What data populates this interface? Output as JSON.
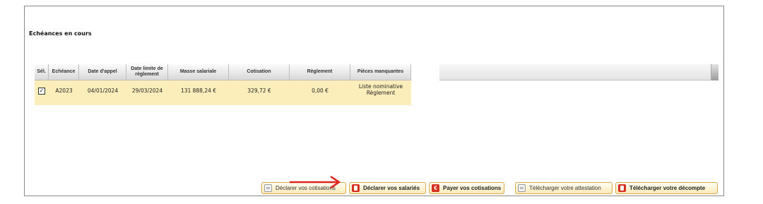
{
  "section_title": "Echéances en cours",
  "table": {
    "headers": [
      "Sél.",
      "Echéance",
      "Date d'appel",
      "Date limite de règlement",
      "Masse salariale",
      "Cotisation",
      "Règlement",
      "Pièces manquantes"
    ],
    "rows": [
      {
        "selected": true,
        "echeance": "A2023",
        "date_appel": "04/01/2024",
        "date_limite": "29/03/2024",
        "masse_salariale": "131 888,24 €",
        "cotisation": "329,72 €",
        "reglement": "0,00 €",
        "pieces_manquantes_1": "Liste nominative",
        "pieces_manquantes_2": "Règlement"
      }
    ]
  },
  "buttons": {
    "declarer_cotisations": "Déclarer vos cotisations",
    "declarer_salaries": "Déclarer vos salariés",
    "payer_cotisations": "Payer vos cotisations",
    "telecharger_attestation": "Télécharger votre attestation",
    "telecharger_decompte": "Télécharger votre décompte"
  },
  "colors": {
    "row_highlight": "#fbeeba",
    "button_border": "#d9a94a",
    "icon_red": "#d6301f",
    "arrow_red": "#e0241b"
  }
}
